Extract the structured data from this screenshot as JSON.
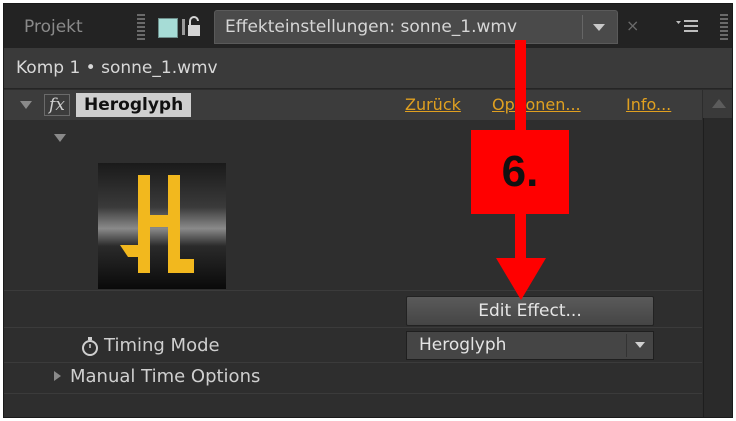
{
  "tabs": {
    "project_label": "Projekt",
    "effects_label": "Effekteinstellungen: sonne_1.wmv",
    "close_symbol": "×"
  },
  "comp_line": "Komp 1 • sonne_1.wmv",
  "effect": {
    "name": "Heroglyph",
    "fx_symbol": "fx",
    "links": {
      "back": "Zurück",
      "options": "Optionen...",
      "info": "Info..."
    }
  },
  "controls": {
    "edit_button": "Edit Effect...",
    "timing_label": "Timing Mode",
    "timing_value": "Heroglyph",
    "manual_label": "Manual Time Options"
  },
  "annotation": {
    "step_label": "6."
  },
  "colors": {
    "panel_bg": "#2e2e2e",
    "link_orange": "#e0a020",
    "annotation_red": "#ff0000",
    "logo_gold": "#f2b81e"
  },
  "icons": [
    "lock-icon",
    "color-swatch",
    "panel-menu-icon",
    "fx-icon",
    "stopwatch-icon",
    "heroglyph-logo"
  ]
}
